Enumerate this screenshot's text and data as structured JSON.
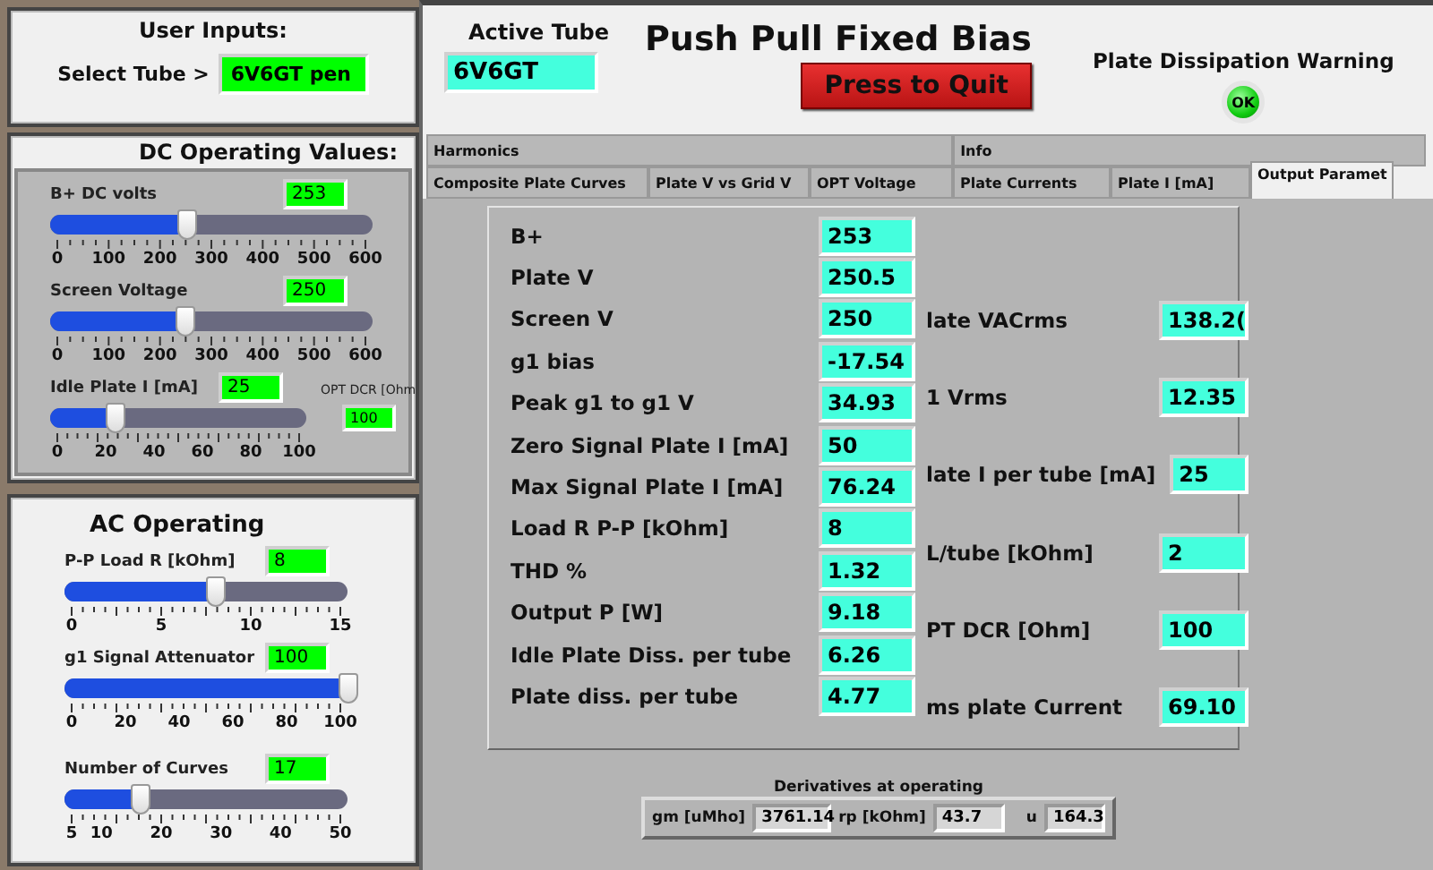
{
  "user_inputs": {
    "title": "User Inputs:",
    "select_label": "Select Tube >",
    "select_value": "6V6GT pen"
  },
  "dc_operating": {
    "title": "DC Operating Values:",
    "sliders": [
      {
        "label": "B+ DC volts",
        "value": "253",
        "level": 0.422,
        "ticks": [
          "0",
          "100",
          "200",
          "300",
          "400",
          "500",
          "600"
        ]
      },
      {
        "label": "Screen Voltage",
        "value": "250",
        "level": 0.417,
        "ticks": [
          "0",
          "100",
          "200",
          "300",
          "400",
          "500",
          "600"
        ]
      },
      {
        "label": "Idle Plate I [mA]",
        "value": "25",
        "level": 0.25,
        "ticks": [
          "0",
          "20",
          "40",
          "60",
          "80",
          "100"
        ]
      }
    ],
    "opt_dcr": {
      "label": "OPT DCR [Ohm",
      "value": "100"
    }
  },
  "ac_operating": {
    "title": "AC Operating",
    "sliders": [
      {
        "label": "P-P  Load R [kOhm]",
        "value": "8",
        "level": 0.533,
        "ticks": [
          "0",
          "5",
          "10",
          "15"
        ]
      },
      {
        "label": "g1 Signal  Attenuator",
        "value": "100",
        "level": 1,
        "ticks": [
          "0",
          "20",
          "40",
          "60",
          "80",
          "100"
        ]
      },
      {
        "label": "Number of Curves",
        "value": "17",
        "level": 0.267,
        "ticks": [
          "5",
          "10",
          "20",
          "30",
          "40",
          "50"
        ]
      }
    ]
  },
  "header": {
    "active_tube_label": "Active Tube",
    "active_tube_value": "6V6GT",
    "title": "Push Pull Fixed Bias",
    "quit_button": "Press to Quit",
    "warning_label": "Plate Dissipation Warning",
    "warning_led": {
      "text": "OK",
      "on": true
    }
  },
  "tab_rows": [
    [
      {
        "label": "Harmonics",
        "selected": false
      },
      {
        "label": "Info",
        "selected": false
      }
    ],
    [
      {
        "label": "Composite Plate Curves",
        "selected": false
      },
      {
        "label": "Plate V vs Grid V",
        "selected": false
      },
      {
        "label": "OPT Voltage",
        "selected": false
      },
      {
        "label": "Plate Currents",
        "selected": false
      },
      {
        "label": "Plate I [mA]",
        "selected": false
      },
      {
        "label": "Output Paramet",
        "selected": true
      }
    ]
  ],
  "outputs_left": [
    {
      "label": "B+",
      "value": "253"
    },
    {
      "label": "Plate V",
      "value": "250.5"
    },
    {
      "label": "Screen V",
      "value": "250"
    },
    {
      "label": "g1 bias",
      "value": "-17.54"
    },
    {
      "label": "Peak g1 to g1 V",
      "value": "34.93"
    },
    {
      "label": "Zero Signal Plate I [mA]",
      "value": "50"
    },
    {
      "label": "Max Signal Plate I [mA]",
      "value": "76.24"
    },
    {
      "label": "Load R P-P [kOhm]",
      "value": "8"
    },
    {
      "label": "THD %",
      "value": "1.32"
    },
    {
      "label": "Output P [W]",
      "value": "9.18"
    },
    {
      "label": "Idle Plate Diss. per tube",
      "value": "6.26"
    },
    {
      "label": "Plate diss. per tube",
      "value": "4.77"
    }
  ],
  "outputs_right": [
    {
      "label": "late VACrms",
      "value": "138.2("
    },
    {
      "label": "1 Vrms",
      "value": "12.35"
    },
    {
      "label": "late I per tube [mA]",
      "value": "25"
    },
    {
      "label": "L/tube [kOhm]",
      "value": "2"
    },
    {
      "label": "PT DCR [Ohm]",
      "value": "100"
    },
    {
      "label": "ms plate Current",
      "value": "69.10"
    }
  ],
  "derivatives": {
    "title": "Derivatives at operating",
    "fields": [
      {
        "label": "gm [uMho]",
        "value": "3761.14"
      },
      {
        "label": "rp [kOhm]",
        "value": "43.7"
      },
      {
        "label": "u",
        "value": "164.3"
      }
    ]
  }
}
